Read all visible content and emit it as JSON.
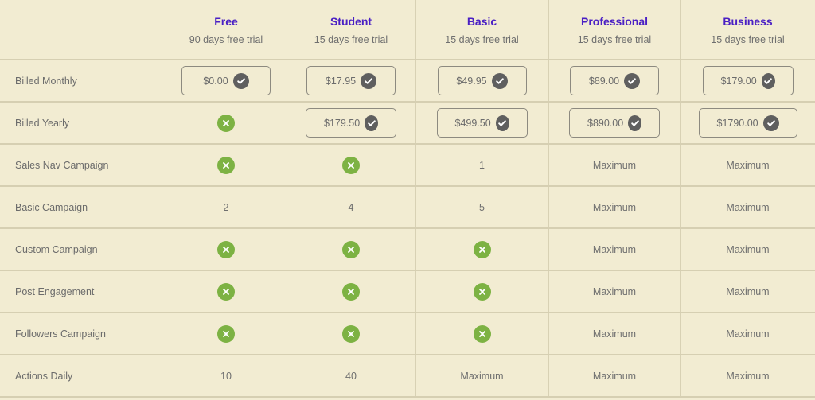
{
  "plans": [
    {
      "name": "Free",
      "trial": "90 days free trial"
    },
    {
      "name": "Student",
      "trial": "15 days free trial"
    },
    {
      "name": "Basic",
      "trial": "15 days free trial"
    },
    {
      "name": "Professional",
      "trial": "15 days free trial"
    },
    {
      "name": "Business",
      "trial": "15 days free trial"
    }
  ],
  "rows": [
    {
      "label": "Billed Monthly",
      "cells": [
        {
          "type": "price",
          "value": "$0.00"
        },
        {
          "type": "price",
          "value": "$17.95"
        },
        {
          "type": "price",
          "value": "$49.95"
        },
        {
          "type": "price",
          "value": "$89.00"
        },
        {
          "type": "price",
          "value": "$179.00"
        }
      ]
    },
    {
      "label": "Billed Yearly",
      "cells": [
        {
          "type": "unavailable"
        },
        {
          "type": "price",
          "value": "$179.50"
        },
        {
          "type": "price",
          "value": "$499.50"
        },
        {
          "type": "price",
          "value": "$890.00"
        },
        {
          "type": "price",
          "value": "$1790.00"
        }
      ]
    },
    {
      "label": "Sales Nav Campaign",
      "cells": [
        {
          "type": "unavailable"
        },
        {
          "type": "unavailable"
        },
        {
          "type": "text",
          "value": "1"
        },
        {
          "type": "text",
          "value": "Maximum"
        },
        {
          "type": "text",
          "value": "Maximum"
        }
      ]
    },
    {
      "label": "Basic Campaign",
      "cells": [
        {
          "type": "text",
          "value": "2"
        },
        {
          "type": "text",
          "value": "4"
        },
        {
          "type": "text",
          "value": "5"
        },
        {
          "type": "text",
          "value": "Maximum"
        },
        {
          "type": "text",
          "value": "Maximum"
        }
      ]
    },
    {
      "label": "Custom Campaign",
      "cells": [
        {
          "type": "unavailable"
        },
        {
          "type": "unavailable"
        },
        {
          "type": "unavailable"
        },
        {
          "type": "text",
          "value": "Maximum"
        },
        {
          "type": "text",
          "value": "Maximum"
        }
      ]
    },
    {
      "label": "Post Engagement",
      "cells": [
        {
          "type": "unavailable"
        },
        {
          "type": "unavailable"
        },
        {
          "type": "unavailable"
        },
        {
          "type": "text",
          "value": "Maximum"
        },
        {
          "type": "text",
          "value": "Maximum"
        }
      ]
    },
    {
      "label": "Followers Campaign",
      "cells": [
        {
          "type": "unavailable"
        },
        {
          "type": "unavailable"
        },
        {
          "type": "unavailable"
        },
        {
          "type": "text",
          "value": "Maximum"
        },
        {
          "type": "text",
          "value": "Maximum"
        }
      ]
    },
    {
      "label": "Actions Daily",
      "cells": [
        {
          "type": "text",
          "value": "10"
        },
        {
          "type": "text",
          "value": "40"
        },
        {
          "type": "text",
          "value": "Maximum"
        },
        {
          "type": "text",
          "value": "Maximum"
        },
        {
          "type": "text",
          "value": "Maximum"
        }
      ]
    }
  ],
  "icons": {
    "price_check": "check-circle-icon",
    "unavailable": "x-circle-icon"
  },
  "colors": {
    "background": "#f2ecd2",
    "plan_name": "#4a1fc4",
    "unavailable_icon": "#7db243",
    "check_icon": "#5f5f5f"
  }
}
